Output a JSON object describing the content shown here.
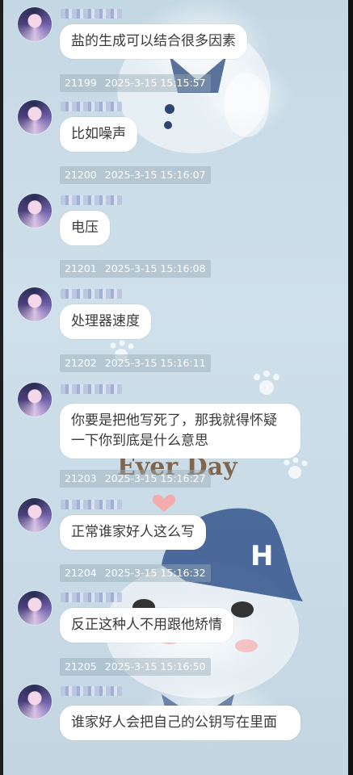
{
  "chat": {
    "messages": [
      {
        "text": "盐的生成可以结合很多因素",
        "id": "21199",
        "time": "2025-3-15 15:15:57"
      },
      {
        "text": "比如噪声",
        "id": "21200",
        "time": "2025-3-15 15:16:07"
      },
      {
        "text": "电压",
        "id": "21201",
        "time": "2025-3-15 15:16:08"
      },
      {
        "text": "处理器速度",
        "id": "21202",
        "time": "2025-3-15 15:16:11"
      },
      {
        "text": "你要是把他写死了，那我就得怀疑一下你到底是什么意思",
        "id": "21203",
        "time": "2025-3-15 15:16:27"
      },
      {
        "text": "正常谁家好人这么写",
        "id": "21204",
        "time": "2025-3-15 15:16:32"
      },
      {
        "text": "反正这种人不用跟他矫情",
        "id": "21205",
        "time": "2025-3-15 15:16:50"
      },
      {
        "text": "谁家好人会把自己的公钥写在里面"
      }
    ]
  },
  "wallpaper": {
    "text": "Ever Day",
    "cap_letter": "H"
  },
  "colors": {
    "bubble_bg": "#ffffff",
    "bubble_text": "#3a3a3a",
    "meta_bg": "rgba(150,170,185,0.45)",
    "wallpaper_base": "#c8dbe6"
  }
}
